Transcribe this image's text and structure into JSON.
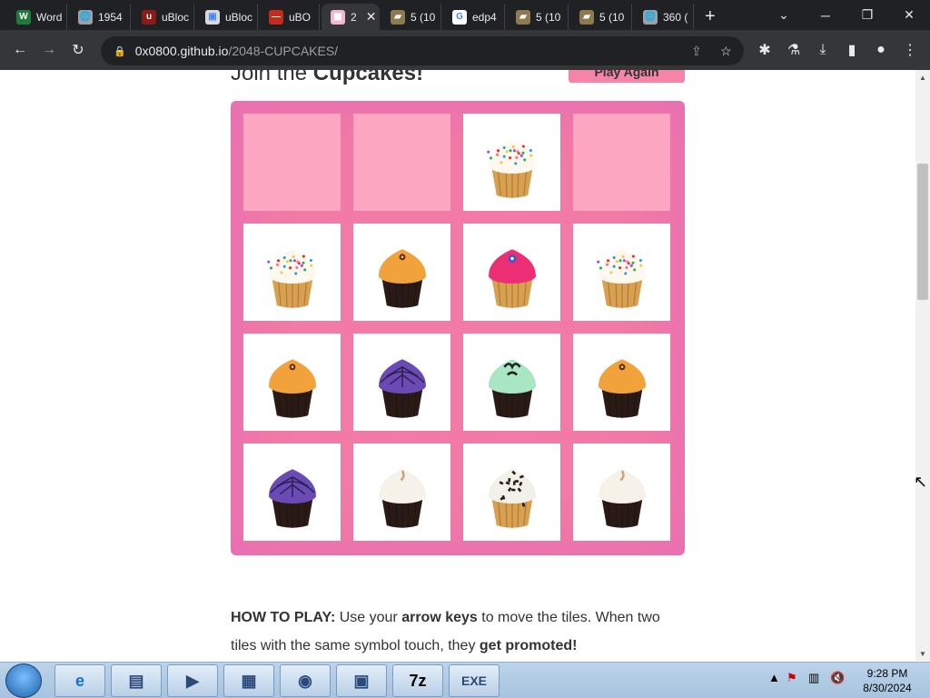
{
  "browser": {
    "tabs": [
      {
        "label": "Word",
        "icon": "word-icon",
        "icon_color": "#1e7b3a",
        "icon_text": "W"
      },
      {
        "label": "1954",
        "icon": "globe-icon",
        "icon_color": "#9aa0a6",
        "icon_text": "🌐"
      },
      {
        "label": "uBloc",
        "icon": "ublock-icon",
        "icon_color": "#8b1a1a",
        "icon_text": "u"
      },
      {
        "label": "uBloc",
        "icon": "image-icon",
        "icon_color": "#d9d9d9",
        "icon_text": "▣"
      },
      {
        "label": "uBO",
        "icon": "ublock-icon",
        "icon_color": "#c42b1c",
        "icon_text": "—"
      },
      {
        "label": "2",
        "icon": "page-icon",
        "icon_color": "#f4b8cc",
        "icon_text": "▦",
        "active": true
      },
      {
        "label": "5 (10",
        "icon": "folder-icon",
        "icon_color": "#8d7a4e",
        "icon_text": "▰"
      },
      {
        "label": "edp4",
        "icon": "google-icon",
        "icon_color": "#ffffff",
        "icon_text": "G"
      },
      {
        "label": "5 (10",
        "icon": "folder-icon",
        "icon_color": "#8d7a4e",
        "icon_text": "▰"
      },
      {
        "label": "5 (10",
        "icon": "folder-icon",
        "icon_color": "#8d7a4e",
        "icon_text": "▰"
      },
      {
        "label": "360 (",
        "icon": "globe-icon",
        "icon_color": "#9aa0a6",
        "icon_text": "🌐"
      }
    ],
    "new_tab": "+",
    "url_host": "0x0800.github.io",
    "url_path": "/2048-CUPCAKES/"
  },
  "page": {
    "join_prefix": "Join the ",
    "join_bold": "Cupcakes!",
    "play_again": "Play Again",
    "howto_label": "HOW TO PLAY:",
    "howto_1": " Use your ",
    "howto_2": "arrow keys",
    "howto_3": " to move the tiles. When two tiles with the same symbol touch, they ",
    "howto_4": "get promoted!"
  },
  "board": {
    "rows": [
      [
        "empty",
        "empty",
        "sprinkle-white",
        "empty"
      ],
      [
        "sprinkle-white",
        "orange",
        "pink",
        "sprinkle-white"
      ],
      [
        "orange",
        "purple-web",
        "mint",
        "orange"
      ],
      [
        "purple-web",
        "white-swirl",
        "cookies",
        "white-swirl"
      ]
    ]
  },
  "taskbar": {
    "apps": [
      {
        "name": "internet-explorer-icon",
        "glyph": "e"
      },
      {
        "name": "file-explorer-icon",
        "glyph": "▤"
      },
      {
        "name": "media-player-icon",
        "glyph": "▶"
      },
      {
        "name": "control-panel-icon",
        "glyph": "▦"
      },
      {
        "name": "chrome-icon",
        "glyph": "◉"
      },
      {
        "name": "installer-icon",
        "glyph": "▣"
      },
      {
        "name": "7zip-icon",
        "glyph": "7z"
      },
      {
        "name": "youtube-exe-icon",
        "glyph": "EXE"
      }
    ],
    "time": "9:28 PM",
    "date": "8/30/2024"
  },
  "colors": {
    "board": "#f27aa6",
    "empty_tile": "#fda7c3",
    "button": "#f683a8"
  }
}
